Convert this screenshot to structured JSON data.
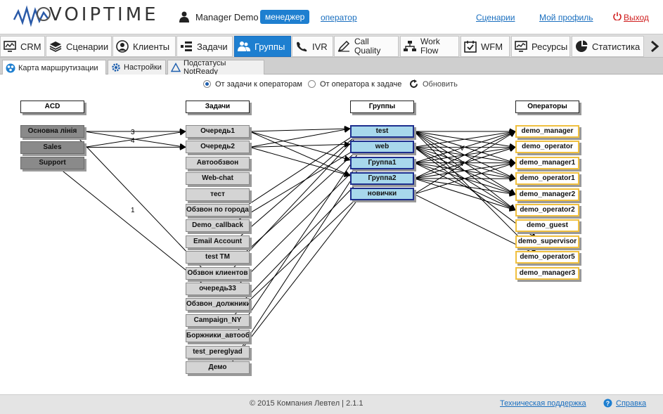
{
  "header": {
    "logo": "VOIPTIME",
    "user_name": "Manager Demo",
    "role_active": "менеджер",
    "role_other": "оператор",
    "links": {
      "scenarios": "Сценарии",
      "profile": "Мой профиль",
      "logout": "Выход"
    }
  },
  "mainnav": [
    {
      "label": "CRM",
      "icon": "monitor-icon"
    },
    {
      "label": "Сценарии",
      "icon": "layers-icon"
    },
    {
      "label": "Клиенты",
      "icon": "person-icon"
    },
    {
      "label": "Задачи",
      "icon": "tasks-icon"
    },
    {
      "label": "Группы",
      "icon": "group-icon",
      "active": true
    },
    {
      "label": "IVR",
      "icon": "ivr-icon"
    },
    {
      "label": "Call Quality",
      "icon": "pen-icon"
    },
    {
      "label": "Work Flow",
      "icon": "workflow-icon"
    },
    {
      "label": "WFM",
      "icon": "calendar-check-icon"
    },
    {
      "label": "Ресурсы",
      "icon": "chart-monitor-icon"
    },
    {
      "label": "Статистика",
      "icon": "pie-icon"
    }
  ],
  "subnav": [
    {
      "label": "Карта маршрутизации",
      "icon": "routing-icon",
      "active": true
    },
    {
      "label": "Настройки",
      "icon": "settings-icon"
    },
    {
      "label": "Подстатусы NotReady",
      "icon": "triangle-icon"
    }
  ],
  "options": {
    "task_to_operators": "От задачи к операторам",
    "operator_to_task": "От оператора к задаче",
    "refresh": "Обновить"
  },
  "columns": {
    "acd": "ACD",
    "tasks": "Задачи",
    "groups": "Группы",
    "operators": "Операторы"
  },
  "acd": [
    "Основна лінія",
    "Sales",
    "Support"
  ],
  "tasks": [
    "Очередь1",
    "Очередь2",
    "Автообзвон",
    "Web-chat",
    "тест",
    "Обзвон по городам",
    "Demo_callback",
    "Email Account",
    "test TM",
    "Обзвон клиентов",
    "очередь33",
    "Обзвон_должники",
    "Campaign_NY",
    "Боржники_автообдзвін",
    "test_pereglyad",
    "Демо"
  ],
  "groups": [
    "test",
    "web",
    "Группа1",
    "Группа2",
    "новички"
  ],
  "operators": [
    "demo_manager",
    "demo_operator",
    "demo_manager1",
    "demo_operator1",
    "demo_manager2",
    "demo_operator2",
    "demo_guest",
    "demo_supervisor",
    "demo_operator5",
    "demo_manager3"
  ],
  "edge_labels": {
    "acd0_task0": "3",
    "acd1_task1": "4",
    "acd2_task": "1",
    "group_op_a": "V",
    "group_op_b": "V"
  },
  "footer": {
    "copyright": "© 2015 Компания Левтел | 2.1.1",
    "support": "Техническая поддержка",
    "help": "Справка"
  },
  "colors": {
    "accent": "#1e7fd0",
    "group_border": "#1e2f8e",
    "group_fill": "#a8d8ec",
    "operator_border": "#f0c040",
    "logout": "#d02020"
  }
}
